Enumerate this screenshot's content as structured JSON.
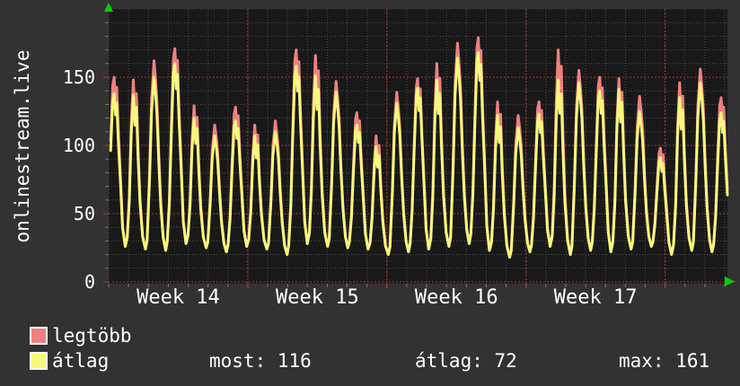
{
  "chart_data": {
    "type": "line",
    "vertical_label": "onlinestream.live",
    "x_tick_labels": [
      "Week 14",
      "Week 15",
      "Week 16",
      "Week 17"
    ],
    "y_tick_labels": [
      "0",
      "50",
      "100",
      "150"
    ],
    "y_ticks": [
      0,
      50,
      100,
      150
    ],
    "ylim": [
      0,
      200
    ],
    "x_span_days": 31,
    "plot_bg": "#191919",
    "grid": {
      "minor_color": "#4c4c4c",
      "major_color": "#b03535",
      "y_minor_step": 10,
      "y_major_step": 50,
      "x_minor_step_days": 1,
      "x_major_step_days": 7,
      "grid_on": true
    },
    "arrow_color": "#00d400",
    "series": [
      {
        "name": "legtöbb",
        "color": "#f08080",
        "daily_peaks": [
          150,
          148,
          162,
          171,
          129,
          115,
          128,
          115,
          118,
          170,
          166,
          147,
          124,
          107,
          139,
          149,
          160,
          175,
          179,
          132,
          122,
          132,
          170,
          155,
          150,
          149,
          136,
          98,
          146,
          156,
          135
        ]
      },
      {
        "name": "átlag",
        "color": "#f7f77c",
        "daily_peaks": [
          138,
          137,
          150,
          160,
          120,
          107,
          118,
          107,
          110,
          158,
          151,
          139,
          115,
          99,
          131,
          142,
          148,
          164,
          168,
          122,
          113,
          123,
          148,
          146,
          140,
          141,
          125,
          91,
          135,
          146,
          124
        ]
      }
    ],
    "daily_lows": [
      28,
      26,
      24,
      23,
      28,
      25,
      22,
      26,
      24,
      20,
      28,
      26,
      25,
      24,
      20,
      22,
      24,
      26,
      28,
      23,
      18,
      22,
      26,
      20,
      23,
      22,
      24,
      26,
      20,
      23,
      22,
      20
    ]
  },
  "legend": {
    "items": [
      {
        "label": "legtöbb",
        "color": "#f08080"
      },
      {
        "label": "átlag",
        "color": "#f7f77c"
      }
    ]
  },
  "stats": [
    {
      "label": "most",
      "value": 116,
      "text": "most: 116"
    },
    {
      "label": "átlag",
      "value": 72,
      "text": "átlag: 72"
    },
    {
      "label": "max",
      "value": 161,
      "text": "max: 161"
    }
  ]
}
